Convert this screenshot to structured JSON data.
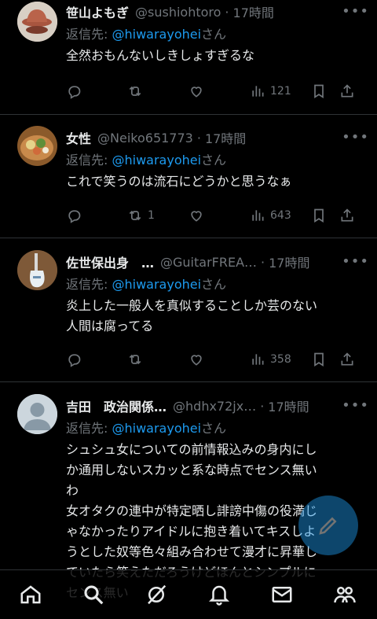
{
  "colors": {
    "background": "#000000",
    "text": "#e7e9ea",
    "muted": "#71767b",
    "accent": "#1d9bf0",
    "divider": "#2f3336"
  },
  "tweets": [
    {
      "name": "笹山よもぎ",
      "handle": "@sushiohtoro",
      "time": "17時間",
      "reply_prefix": "返信先: ",
      "reply_mention": "@hiwarayohei",
      "reply_suffix": "さん",
      "text": "全然おもんないしきしょすぎるな",
      "replies": "",
      "retweets": "",
      "views": "121"
    },
    {
      "name": "女性",
      "handle": "@Neiko651773",
      "time": "17時間",
      "reply_prefix": "返信先: ",
      "reply_mention": "@hiwarayohei",
      "reply_suffix": "さん",
      "text": "これで笑うのは流石にどうかと思うなぁ",
      "replies": "",
      "retweets": "1",
      "views": "643"
    },
    {
      "name": "佐世保出身　…",
      "handle": "@GuitarFREA…",
      "time": "17時間",
      "reply_prefix": "返信先: ",
      "reply_mention": "@hiwarayohei",
      "reply_suffix": "さん",
      "text": "炎上した一般人を真似することしか芸のない\n人間は腐ってる",
      "replies": "",
      "retweets": "",
      "views": "358"
    },
    {
      "name": "吉田　政治関係…",
      "handle": "@hdhx72jx…",
      "time": "17時間",
      "reply_prefix": "返信先: ",
      "reply_mention": "@hiwarayohei",
      "reply_suffix": "さん",
      "text": "シュシュ女についての前情報込みの身内にし\nか通用しないスカッと系な時点でセンス無い\nわ\n女オタクの連中が特定晒し誹謗中傷の役満じ\nゃなかったりアイドルに抱き着いてキスしよ\nうとした奴等色々組み合わせて漫才に昇華し\nていたら笑えただろうけどほんとシンプルに\nセンス無い",
      "replies": "",
      "retweets": "",
      "views": ""
    }
  ],
  "nav": [
    "home-icon",
    "search-icon",
    "grok-icon",
    "notifications-icon",
    "messages-icon",
    "communities-icon"
  ]
}
